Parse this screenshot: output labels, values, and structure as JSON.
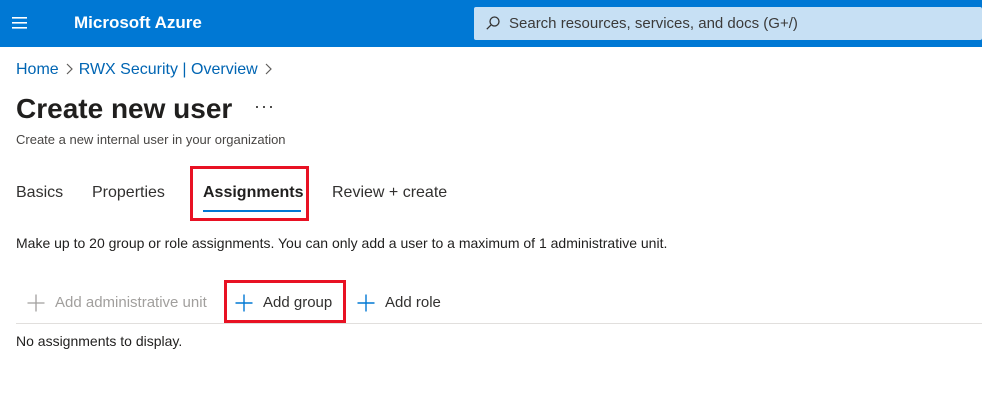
{
  "header": {
    "brand": "Microsoft Azure",
    "search_placeholder": "Search resources, services, and docs (G+/)",
    "color": "#0078d4"
  },
  "breadcrumb": [
    "Home",
    "RWX Security | Overview"
  ],
  "page": {
    "title": "Create new user",
    "more": "···",
    "subtitle": "Create a new internal user in your organization"
  },
  "tabs": [
    {
      "label": "Basics",
      "active": false
    },
    {
      "label": "Properties",
      "active": false
    },
    {
      "label": "Assignments",
      "active": true
    },
    {
      "label": "Review + create",
      "active": false
    }
  ],
  "info_text": "Make up to 20 group or role assignments. You can only add a user to a maximum of 1 administrative unit.",
  "commands": [
    {
      "label": "Add administrative unit",
      "enabled": false,
      "icon": "plus-icon"
    },
    {
      "label": "Add group",
      "enabled": true,
      "icon": "plus-icon"
    },
    {
      "label": "Add role",
      "enabled": true,
      "icon": "plus-icon"
    }
  ],
  "empty_text": "No assignments to display.",
  "highlight_color": "#e81123"
}
